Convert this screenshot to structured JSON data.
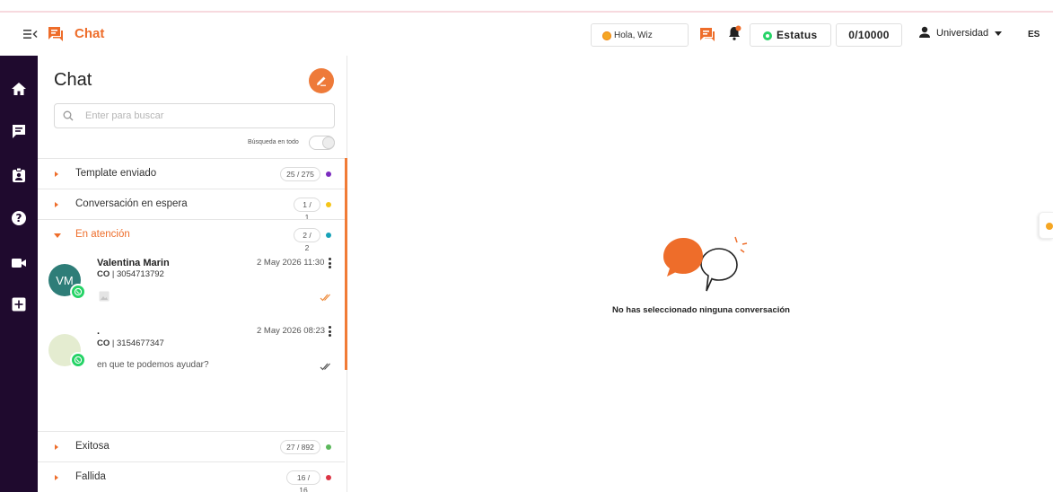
{
  "header": {
    "app_title": "Chat",
    "greeting": "Hola, Wiz",
    "status_label": "Estatus",
    "counter": "0/10000",
    "user_name": "Universidad",
    "language": "ES"
  },
  "rail": {
    "items": [
      "home-icon",
      "chat-icon",
      "contacts-icon",
      "help-icon",
      "video-icon",
      "add-icon"
    ]
  },
  "panel": {
    "title": "Chat",
    "search_placeholder": "Enter para buscar",
    "search_all_label": "Búsqueda en todo",
    "groups": [
      {
        "label": "Template enviado",
        "count": "25 / 275",
        "color": "#7b2cbf",
        "expanded": false
      },
      {
        "label": "Conversación en espera",
        "count": "1 / 1",
        "color": "#f5c518",
        "expanded": false
      },
      {
        "label": "En atención",
        "count": "2 / 2",
        "color": "#17a2b8",
        "expanded": true
      },
      {
        "label": "Exitosa",
        "count": "27 / 892",
        "color": "#5cb85c",
        "expanded": false
      },
      {
        "label": "Fallida",
        "count": "16 / 16",
        "color": "#dc3545",
        "expanded": false
      }
    ],
    "conversations": [
      {
        "initials": "VM",
        "name": "Valentina Marin",
        "country": "CO",
        "phone": "| 3054713792",
        "date": "2 May 2026 11:30",
        "message": "",
        "avatar_color": "#2e7d78"
      },
      {
        "initials": "",
        "name": ".",
        "country": "CO",
        "phone": "| 3154677347",
        "date": "2 May 2026 08:23",
        "message": "en que te podemos ayudar?",
        "avatar_color": "#e4ecd0"
      }
    ]
  },
  "main": {
    "empty_message": "No has seleccionado ninguna conversación"
  },
  "colors": {
    "accent": "#ee6d2a",
    "rail_bg": "#1f0a2e",
    "whatsapp": "#25d366"
  }
}
